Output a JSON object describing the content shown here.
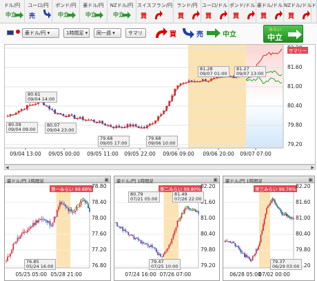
{
  "tabs": [
    {
      "label": "ドル/円",
      "signal": "中立",
      "type": "neutral",
      "arrow": "right"
    },
    {
      "label": "ユーロ/円",
      "signal": "売",
      "type": "sell",
      "arrow": "down"
    },
    {
      "label": "ポンド/円",
      "signal": "中立",
      "type": "neutral",
      "arrow": "right"
    },
    {
      "label": "豪ドル/円",
      "signal": "中立",
      "type": "neutral",
      "arrow": "right"
    },
    {
      "label": "NZドル/円",
      "signal": "中立",
      "type": "neutral",
      "arrow": "right"
    },
    {
      "label": "スイスフラン/円",
      "signal": "買",
      "type": "buy",
      "arrow": "up"
    },
    {
      "label": "ランド/円",
      "signal": "買",
      "type": "buy",
      "arrow": "up"
    },
    {
      "label": "ユーロ/ドル",
      "signal": "買",
      "type": "buy",
      "arrow": "up"
    },
    {
      "label": "ポンド/ドル",
      "signal": "買",
      "type": "buy",
      "arrow": "up"
    },
    {
      "label": "豪ドル/ドル",
      "signal": "買",
      "type": "buy",
      "arrow": "up"
    },
    {
      "label": "NZドル/ドル",
      "signal": "買",
      "type": "buy",
      "arrow": "up"
    },
    {
      "label": "ドル/",
      "signal": "中",
      "type": "neutral",
      "arrow": "none"
    }
  ],
  "toolbar": {
    "pair": "豪ドル/円",
    "interval": "1時間足",
    "period": "同一週",
    "summary": "サマリ",
    "legend_buy": "買",
    "legend_sell": "売",
    "legend_neutral": "中立",
    "current_small": "みらい",
    "current_signal": "中立"
  },
  "main": {
    "x_ticks": [
      "09/04 13:00",
      "09/05 00:00",
      "09/05 11:00",
      "09/05 22:00",
      "09/06 09:00",
      "09/06 20:00",
      "09/07 07:00"
    ],
    "y_ticks": [
      "82.20",
      "81.60",
      "81.00",
      "80.40",
      "79.80",
      "79.20"
    ],
    "notes": [
      {
        "t1": "80.61",
        "t2": "09/04 14:00"
      },
      {
        "t1": "80.09",
        "t2": "09/04 09:00"
      },
      {
        "t1": "80.07",
        "t2": "09/04 23:00"
      },
      {
        "t1": "79.68",
        "t2": "09/05 17:00"
      },
      {
        "t1": "79.68",
        "t2": "09/06 10:00"
      },
      {
        "t1": "81.28",
        "t2": "09/07 01:00"
      },
      {
        "t1": "81.27",
        "t2": "09/07 13:00"
      }
    ],
    "sim_label": "サマリー"
  },
  "panels": [
    {
      "title": "豪ドル/円 1時間足",
      "sim": "第一みらい 99.88%",
      "y_ticks": [
        "78.80",
        "78.40",
        "78.00",
        "77.60",
        "77.20",
        "76.80"
      ],
      "x_ticks": [
        "05/25 05:00",
        "05/28 21:00"
      ],
      "notes": [
        {
          "t1": "76.85",
          "t2": "05/24 16:00"
        }
      ]
    },
    {
      "title": "豪ドル/円 1時間足",
      "sim": "第二みらい 99.80%",
      "y_ticks": [
        "82.20",
        "81.60",
        "81.00",
        "80.40",
        "79.80",
        "79.20"
      ],
      "x_ticks": [
        "07/24 16:00",
        "07/26 07:00"
      ],
      "notes": [
        {
          "t1": "80.79",
          "t2": "07/21 05:00"
        },
        {
          "t1": "81.49",
          "t2": "07/26 22:00"
        },
        {
          "t1": "79.47",
          "t2": "07/25 10:00"
        }
      ]
    },
    {
      "title": "豪ドル/円 1時間足",
      "sim": "第三みらい 99.78%",
      "y_ticks": [
        "82.20",
        "81.60",
        "81.00",
        "80.40",
        "79.80",
        "79.20"
      ],
      "x_ticks": [
        "06/28 05:00",
        "07/02 00:00"
      ],
      "notes": [
        {
          "t1": "79.37",
          "t2": "06/29 03:00"
        }
      ]
    }
  ],
  "colors": {
    "buy": "#d00000",
    "sell": "#1a3fb0",
    "neutral": "#2a8a2a",
    "highlight": "#fbe3b3",
    "sim_bg": "#fde0e0",
    "candle_up": "#d9232f",
    "candle_down": "#2a49c8",
    "ma": "#c8382b"
  }
}
